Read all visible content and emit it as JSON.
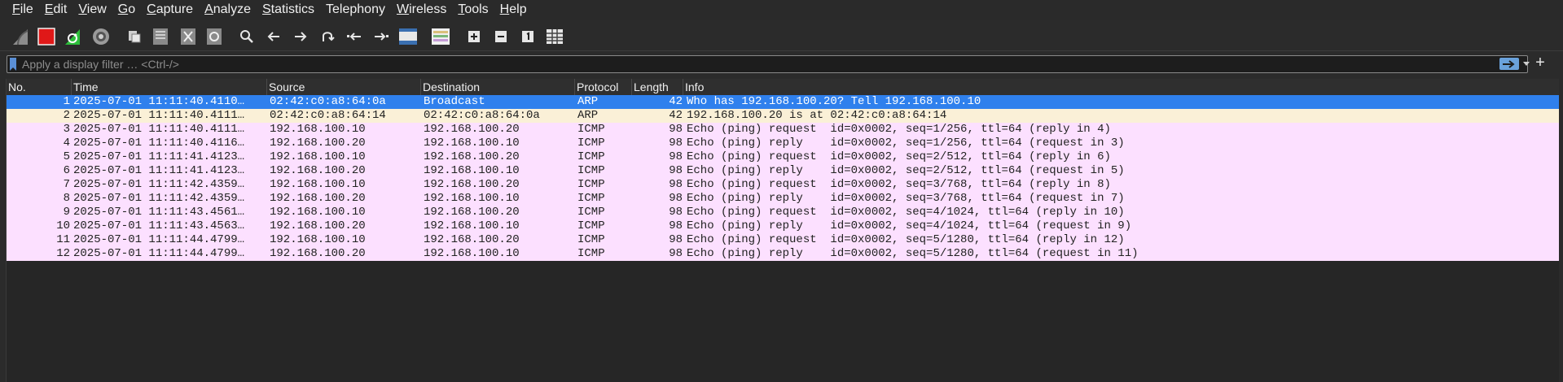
{
  "menu": [
    {
      "acc": "F",
      "rest": "ile"
    },
    {
      "acc": "E",
      "rest": "dit"
    },
    {
      "acc": "V",
      "rest": "iew"
    },
    {
      "acc": "G",
      "rest": "o"
    },
    {
      "acc": "C",
      "rest": "apture"
    },
    {
      "acc": "A",
      "rest": "nalyze"
    },
    {
      "acc": "S",
      "rest": "tatistics"
    },
    {
      "acc": "",
      "rest": "Telephony"
    },
    {
      "acc": "W",
      "rest": "ireless"
    },
    {
      "acc": "T",
      "rest": "ools"
    },
    {
      "acc": "H",
      "rest": "elp"
    }
  ],
  "toolbar": {
    "buttons": [
      "start-capture-icon",
      "stop-capture-icon",
      "restart-capture-icon",
      "capture-options-icon",
      "open-file-icon",
      "save-file-icon",
      "close-file-icon",
      "reload-file-icon",
      "find-packet-icon",
      "go-back-icon",
      "go-forward-icon",
      "go-to-packet-icon",
      "first-packet-icon",
      "last-packet-icon",
      "auto-scroll-icon",
      "colorize-icon",
      "zoom-in-icon",
      "zoom-out-icon",
      "normal-size-icon",
      "resize-columns-icon"
    ]
  },
  "filter": {
    "placeholder": "Apply a display filter … <Ctrl-/>",
    "value": ""
  },
  "columns": [
    "No.",
    "Time",
    "Source",
    "Destination",
    "Protocol",
    "Length",
    "Info"
  ],
  "packets": [
    {
      "no": "1",
      "time": "2025-07-01 11:11:40.4110…",
      "src": "02:42:c0:a8:64:0a",
      "dst": "Broadcast",
      "proto": "ARP",
      "len": "42",
      "info": "Who has 192.168.100.20? Tell 192.168.100.10",
      "type": "arp",
      "selected": true
    },
    {
      "no": "2",
      "time": "2025-07-01 11:11:40.4111…",
      "src": "02:42:c0:a8:64:14",
      "dst": "02:42:c0:a8:64:0a",
      "proto": "ARP",
      "len": "42",
      "info": "192.168.100.20 is at 02:42:c0:a8:64:14",
      "type": "arp",
      "selected": false
    },
    {
      "no": "3",
      "time": "2025-07-01 11:11:40.4111…",
      "src": "192.168.100.10",
      "dst": "192.168.100.20",
      "proto": "ICMP",
      "len": "98",
      "info": "Echo (ping) request  id=0x0002, seq=1/256, ttl=64 (reply in 4)",
      "type": "icmp",
      "selected": false
    },
    {
      "no": "4",
      "time": "2025-07-01 11:11:40.4116…",
      "src": "192.168.100.20",
      "dst": "192.168.100.10",
      "proto": "ICMP",
      "len": "98",
      "info": "Echo (ping) reply    id=0x0002, seq=1/256, ttl=64 (request in 3)",
      "type": "icmp",
      "selected": false
    },
    {
      "no": "5",
      "time": "2025-07-01 11:11:41.4123…",
      "src": "192.168.100.10",
      "dst": "192.168.100.20",
      "proto": "ICMP",
      "len": "98",
      "info": "Echo (ping) request  id=0x0002, seq=2/512, ttl=64 (reply in 6)",
      "type": "icmp",
      "selected": false
    },
    {
      "no": "6",
      "time": "2025-07-01 11:11:41.4123…",
      "src": "192.168.100.20",
      "dst": "192.168.100.10",
      "proto": "ICMP",
      "len": "98",
      "info": "Echo (ping) reply    id=0x0002, seq=2/512, ttl=64 (request in 5)",
      "type": "icmp",
      "selected": false
    },
    {
      "no": "7",
      "time": "2025-07-01 11:11:42.4359…",
      "src": "192.168.100.10",
      "dst": "192.168.100.20",
      "proto": "ICMP",
      "len": "98",
      "info": "Echo (ping) request  id=0x0002, seq=3/768, ttl=64 (reply in 8)",
      "type": "icmp",
      "selected": false
    },
    {
      "no": "8",
      "time": "2025-07-01 11:11:42.4359…",
      "src": "192.168.100.20",
      "dst": "192.168.100.10",
      "proto": "ICMP",
      "len": "98",
      "info": "Echo (ping) reply    id=0x0002, seq=3/768, ttl=64 (request in 7)",
      "type": "icmp",
      "selected": false
    },
    {
      "no": "9",
      "time": "2025-07-01 11:11:43.4561…",
      "src": "192.168.100.10",
      "dst": "192.168.100.20",
      "proto": "ICMP",
      "len": "98",
      "info": "Echo (ping) request  id=0x0002, seq=4/1024, ttl=64 (reply in 10)",
      "type": "icmp",
      "selected": false
    },
    {
      "no": "10",
      "time": "2025-07-01 11:11:43.4563…",
      "src": "192.168.100.20",
      "dst": "192.168.100.10",
      "proto": "ICMP",
      "len": "98",
      "info": "Echo (ping) reply    id=0x0002, seq=4/1024, ttl=64 (request in 9)",
      "type": "icmp",
      "selected": false
    },
    {
      "no": "11",
      "time": "2025-07-01 11:11:44.4799…",
      "src": "192.168.100.10",
      "dst": "192.168.100.20",
      "proto": "ICMP",
      "len": "98",
      "info": "Echo (ping) request  id=0x0002, seq=5/1280, ttl=64 (reply in 12)",
      "type": "icmp",
      "selected": false
    },
    {
      "no": "12",
      "time": "2025-07-01 11:11:44.4799…",
      "src": "192.168.100.20",
      "dst": "192.168.100.10",
      "proto": "ICMP",
      "len": "98",
      "info": "Echo (ping) reply    id=0x0002, seq=5/1280, ttl=64 (request in 11)",
      "type": "icmp",
      "selected": false
    }
  ],
  "colors": {
    "selected": "#2f80ed",
    "arp": "#faf0d7",
    "icmp": "#fce0ff",
    "accent": "#5a8fd6"
  }
}
